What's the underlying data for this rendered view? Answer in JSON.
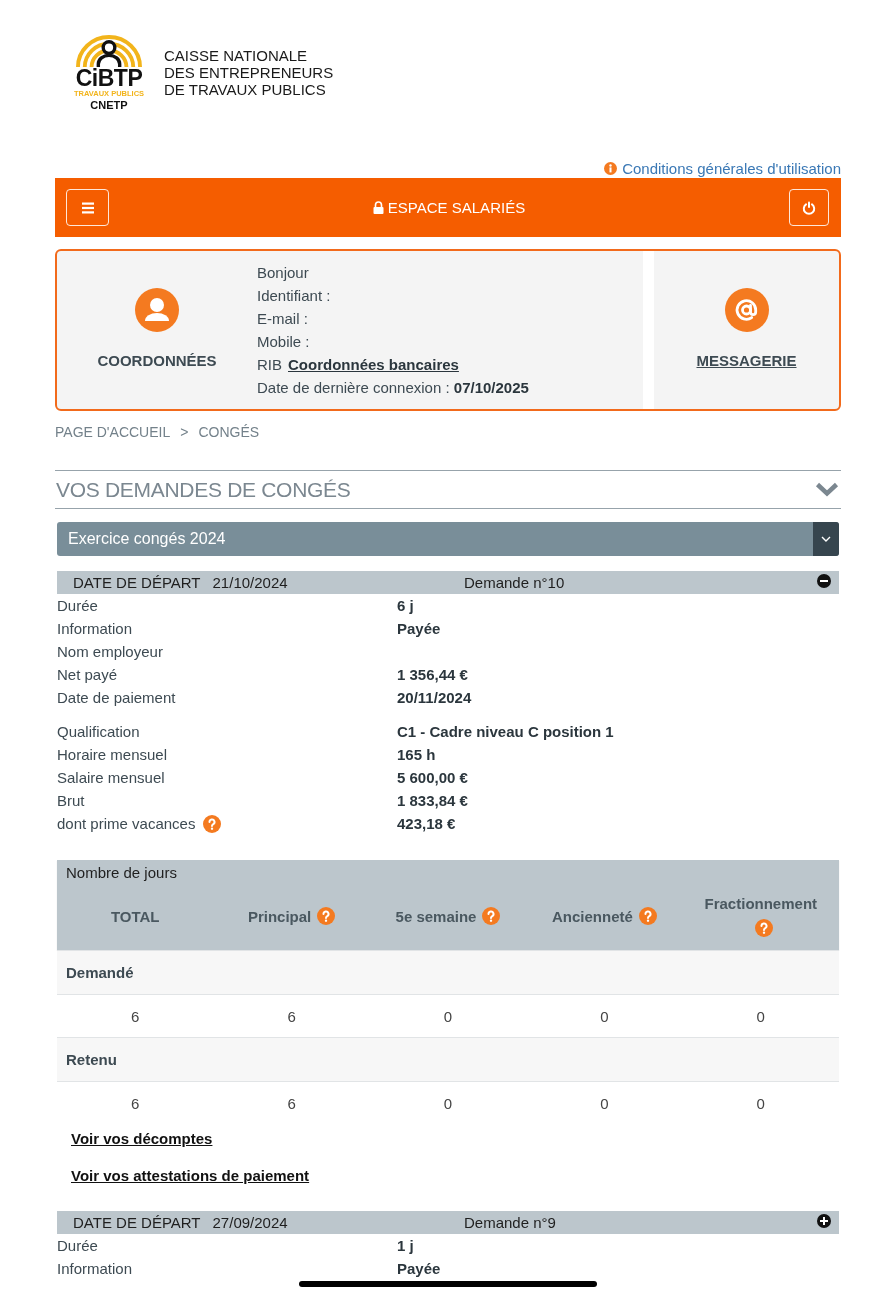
{
  "logo": {
    "brand": "CiBTP",
    "tagline": "TRAVAUX PUBLICS",
    "subtitle": "CNETP"
  },
  "org_name": [
    "CAISSE NATIONALE",
    "DES ENTREPRENEURS",
    "DE TRAVAUX PUBLICS"
  ],
  "terms_link": "Conditions générales d'utilisation",
  "top_bar": {
    "title": "ESPACE SALARIÉS"
  },
  "profile": {
    "contact_label": "COORDONNÉES",
    "lines": [
      {
        "kind": "text",
        "text": "Bonjour"
      },
      {
        "kind": "text",
        "text": "Identifiant :"
      },
      {
        "kind": "text",
        "text": "E-mail :"
      },
      {
        "kind": "text",
        "text": "Mobile :"
      },
      {
        "kind": "link",
        "label": "RIB",
        "link": "Coordonnées bancaires"
      },
      {
        "kind": "text",
        "text": "Date de dernière connexion : **07/10/2025**"
      }
    ],
    "messaging_label": "MESSAGERIE"
  },
  "breadcrumb": {
    "items": [
      "PAGE D'ACCUEIL",
      "CONGÉS"
    ],
    "separator": ">"
  },
  "section": {
    "title": "VOS DEMANDES DE CONGÉS"
  },
  "period_select": {
    "value": "Exercice congés 2024"
  },
  "requests": [
    {
      "date_label": "DATE DE DÉPART",
      "date": "21/10/2024",
      "number": "Demande n°10",
      "expanded": true,
      "detail_groups": [
        [
          {
            "label": "Durée",
            "value": "6 j",
            "help": false
          },
          {
            "label": "Information",
            "value": "Payée",
            "help": false
          },
          {
            "label": "Nom employeur",
            "help": false
          },
          {
            "label": "Net payé",
            "value": "1 356,44 €",
            "help": false
          },
          {
            "label": "Date de paiement",
            "value": "20/11/2024",
            "help": false
          }
        ],
        [
          {
            "label": "Qualification",
            "value": "C1 - Cadre niveau C position 1",
            "help": false
          },
          {
            "label": "Horaire mensuel",
            "value": "165 h",
            "help": false
          },
          {
            "label": "Salaire mensuel",
            "value": "5 600,00 €",
            "help": false
          },
          {
            "label": "Brut",
            "value": "1 833,84 €",
            "help": false
          },
          {
            "label": "dont prime vacances",
            "value": "423,18 €",
            "help": true
          }
        ]
      ],
      "days": {
        "title": "Nombre de jours",
        "columns": [
          {
            "label": "TOTAL",
            "help": false
          },
          {
            "label": "Principal",
            "help": true
          },
          {
            "label": "5e semaine",
            "help": true
          },
          {
            "label": "Ancienneté",
            "help": true
          },
          {
            "label": "Fractionnement",
            "help": true
          }
        ],
        "groups": [
          {
            "label": "Demandé",
            "values": [
              "6",
              "6",
              "0",
              "0",
              "0"
            ]
          },
          {
            "label": "Retenu",
            "values": [
              "6",
              "6",
              "0",
              "0",
              "0"
            ]
          }
        ]
      },
      "links": [
        "Voir vos décomptes",
        "Voir vos attestations de paiement"
      ]
    },
    {
      "date_label": "DATE DE DÉPART",
      "date": "27/09/2024",
      "number": "Demande n°9",
      "expanded": false,
      "detail_groups": [
        [
          {
            "label": "Durée",
            "value": "1 j",
            "help": false
          },
          {
            "label": "Information",
            "value": "Payée",
            "help": false
          }
        ]
      ]
    }
  ]
}
